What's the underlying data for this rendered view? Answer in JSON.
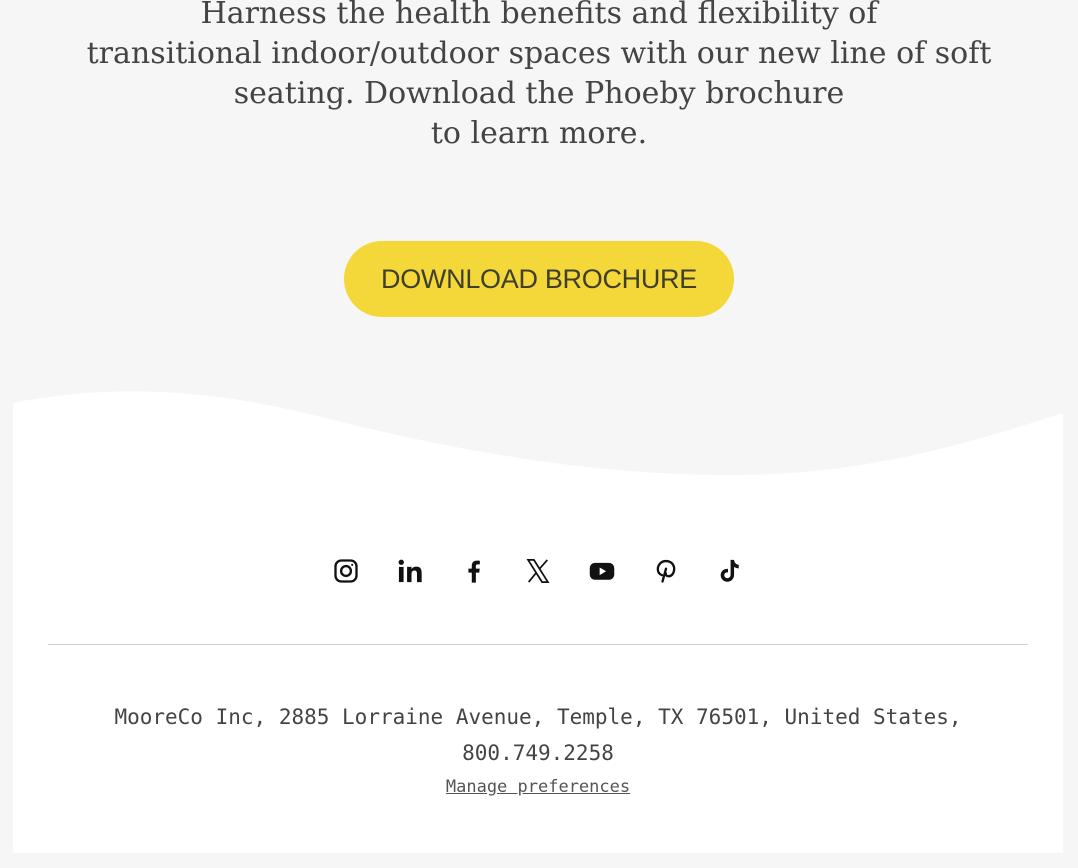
{
  "intro": {
    "lines": [
      "Harness the health benefits and flexibility of",
      "transitional indoor/outdoor spaces with our new line of soft",
      "seating. Download the Phoeby brochure",
      "to learn more."
    ]
  },
  "cta": {
    "label": "DOWNLOAD BROCHURE",
    "color": "#f4d738"
  },
  "social": {
    "icons": [
      "instagram-icon",
      "linkedin-icon",
      "facebook-icon",
      "x-icon",
      "youtube-icon",
      "pinterest-icon",
      "tiktok-icon"
    ]
  },
  "footer": {
    "address_line1": "MooreCo Inc, 2885 Lorraine Avenue, Temple, TX 76501, United States,",
    "address_line2": "800.749.2258",
    "manage_preferences": "Manage preferences"
  }
}
